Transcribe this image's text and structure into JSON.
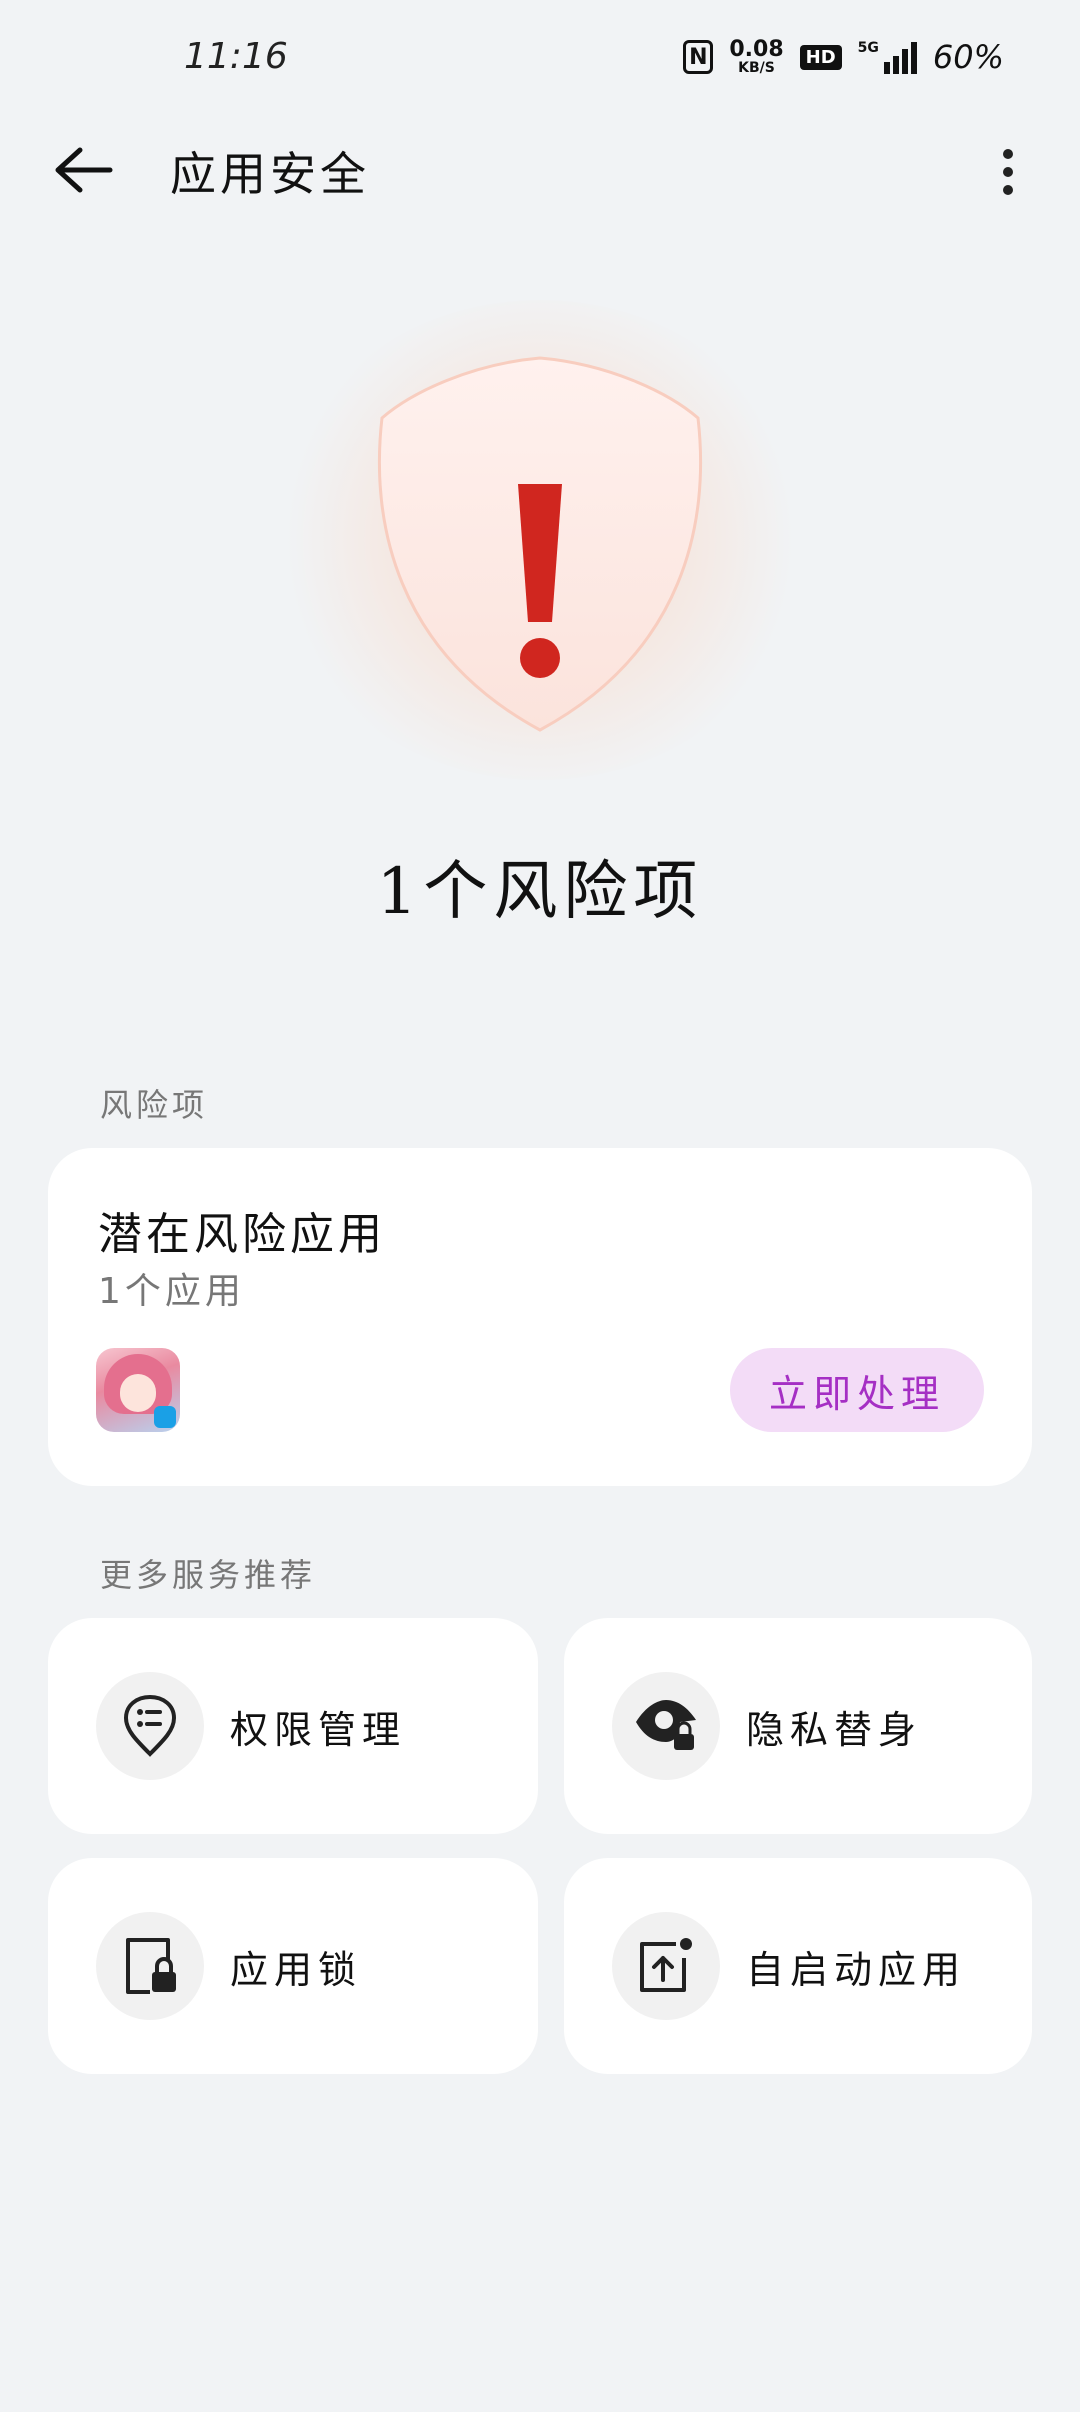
{
  "status_bar": {
    "time": "11:16",
    "nfc": "N",
    "net_speed_value": "0.08",
    "net_speed_unit": "KB/S",
    "hd": "HD",
    "network": "5G",
    "battery": "60%"
  },
  "header": {
    "title": "应用安全"
  },
  "summary": {
    "risk_count_text": "1个风险项"
  },
  "risk_section": {
    "label": "风险项",
    "card": {
      "title": "潜在风险应用",
      "subtitle": "1个应用",
      "action_label": "立即处理"
    }
  },
  "services_section": {
    "label": "更多服务推荐",
    "items": [
      {
        "label": "权限管理",
        "icon": "permission-pin-icon"
      },
      {
        "label": "隐私替身",
        "icon": "privacy-eye-lock-icon"
      },
      {
        "label": "应用锁",
        "icon": "app-lock-icon"
      },
      {
        "label": "自启动应用",
        "icon": "auto-start-icon"
      }
    ]
  },
  "colors": {
    "background": "#f1f3f5",
    "warning_red": "#d0261f",
    "action_bg": "#f3dcf7",
    "action_text": "#a52fc4"
  }
}
